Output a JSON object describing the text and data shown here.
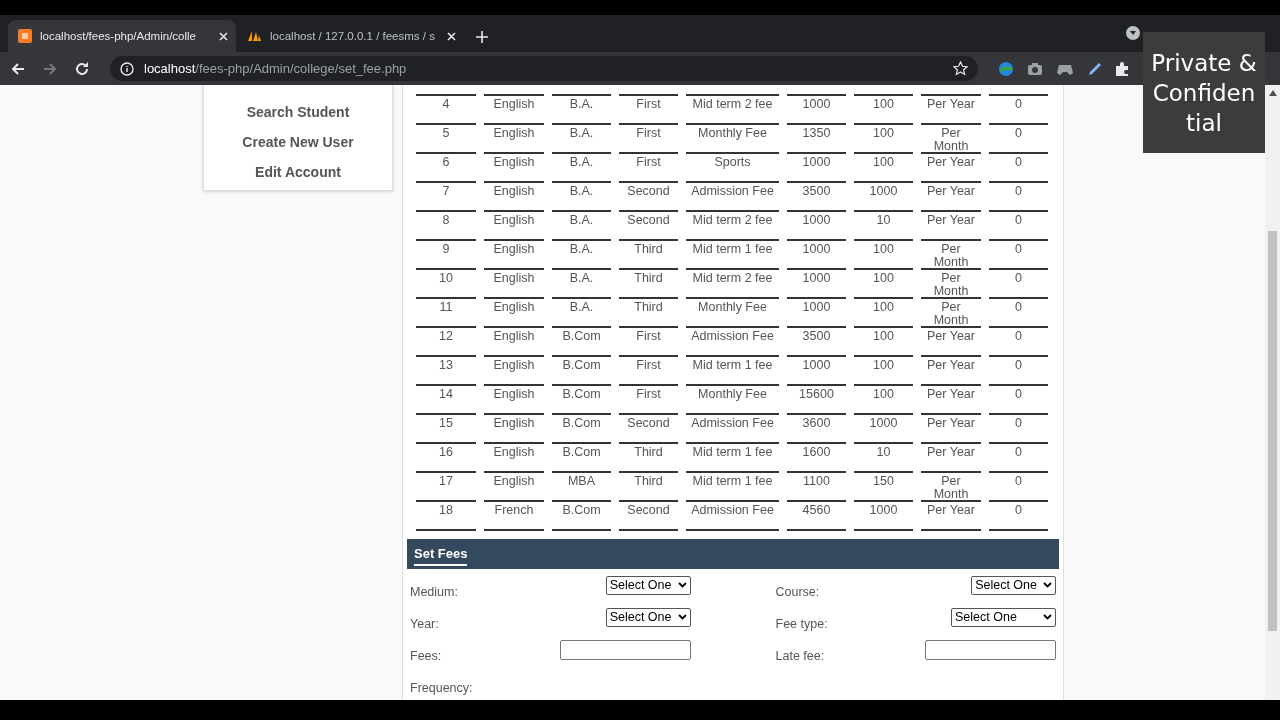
{
  "browser": {
    "tabs": [
      {
        "title": "localhost/fees-php/Admin/colle",
        "selected": true
      },
      {
        "title": "localhost / 127.0.0.1 / feesms / s",
        "selected": false
      }
    ],
    "address": {
      "host": "localhost",
      "path": "/fees-php/Admin/college/set_fee.php"
    }
  },
  "sidebar": {
    "items": [
      "Search Student",
      "Create New User",
      "Edit Account"
    ]
  },
  "table": {
    "rows": [
      [
        "4",
        "English",
        "B.A.",
        "First",
        "Mid term 2 fee",
        "1000",
        "100",
        "Per Year",
        "0"
      ],
      [
        "5",
        "English",
        "B.A.",
        "First",
        "Monthly Fee",
        "1350",
        "100",
        "Per Month",
        "0"
      ],
      [
        "6",
        "English",
        "B.A.",
        "First",
        "Sports",
        "1000",
        "100",
        "Per Year",
        "0"
      ],
      [
        "7",
        "English",
        "B.A.",
        "Second",
        "Admission Fee",
        "3500",
        "1000",
        "Per Year",
        "0"
      ],
      [
        "8",
        "English",
        "B.A.",
        "Second",
        "Mid term 2 fee",
        "1000",
        "10",
        "Per Year",
        "0"
      ],
      [
        "9",
        "English",
        "B.A.",
        "Third",
        "Mid term 1 fee",
        "1000",
        "100",
        "Per Month",
        "0"
      ],
      [
        "10",
        "English",
        "B.A.",
        "Third",
        "Mid term 2 fee",
        "1000",
        "100",
        "Per Month",
        "0"
      ],
      [
        "11",
        "English",
        "B.A.",
        "Third",
        "Monthly Fee",
        "1000",
        "100",
        "Per Month",
        "0"
      ],
      [
        "12",
        "English",
        "B.Com",
        "First",
        "Admission Fee",
        "3500",
        "100",
        "Per Year",
        "0"
      ],
      [
        "13",
        "English",
        "B.Com",
        "First",
        "Mid term 1 fee",
        "1000",
        "100",
        "Per Year",
        "0"
      ],
      [
        "14",
        "English",
        "B.Com",
        "First",
        "Monthly Fee",
        "15600",
        "100",
        "Per Year",
        "0"
      ],
      [
        "15",
        "English",
        "B.Com",
        "Second",
        "Admission Fee",
        "3600",
        "1000",
        "Per Year",
        "0"
      ],
      [
        "16",
        "English",
        "B.Com",
        "Third",
        "Mid term 1 fee",
        "1600",
        "10",
        "Per Year",
        "0"
      ],
      [
        "17",
        "English",
        "MBA",
        "Third",
        "Mid term 1 fee",
        "1100",
        "150",
        "Per Month",
        "0"
      ],
      [
        "18",
        "French",
        "B.Com",
        "Second",
        "Admission Fee",
        "4560",
        "1000",
        "Per Year",
        "0"
      ]
    ]
  },
  "set_fees": {
    "title": "Set Fees",
    "fields": [
      {
        "label": "Medium:",
        "kind": "select",
        "value": "Select One"
      },
      {
        "label": "Course:",
        "kind": "select",
        "value": "Select One"
      },
      {
        "label": "Year:",
        "kind": "select",
        "value": "Select One"
      },
      {
        "label": "Fee type:",
        "kind": "select-wide",
        "value": "Select One"
      },
      {
        "label": "Fees:",
        "kind": "text"
      },
      {
        "label": "Late fee:",
        "kind": "text"
      },
      {
        "label": "Frequency:",
        "kind": "label"
      }
    ]
  },
  "overlay": {
    "text": "Private & Confidential"
  }
}
